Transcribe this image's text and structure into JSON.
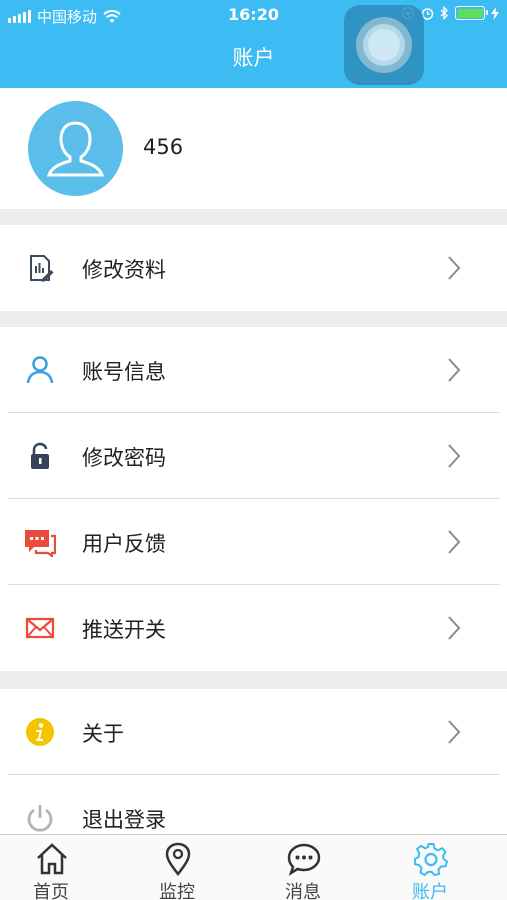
{
  "status_bar": {
    "carrier": "中国移动",
    "time": "16:20"
  },
  "header": {
    "title": "账户"
  },
  "profile": {
    "username": "456"
  },
  "menu": [
    {
      "label": "修改资料",
      "icon": "edit-profile-icon"
    },
    {
      "label": "账号信息",
      "icon": "user-icon",
      "color": "#3a9fe0"
    },
    {
      "label": "修改密码",
      "icon": "lock-icon",
      "color": "#34435a"
    },
    {
      "label": "用户反馈",
      "icon": "feedback-icon",
      "color": "#e94b3c"
    },
    {
      "label": "推送开关",
      "icon": "mail-icon",
      "color": "#e94b3c"
    },
    {
      "label": "关于",
      "icon": "info-icon",
      "color": "#f5c400"
    },
    {
      "label": "退出登录",
      "icon": "power-icon",
      "color": "#b0b6b8"
    }
  ],
  "tabs": [
    {
      "label": "首页",
      "icon": "home-icon"
    },
    {
      "label": "监控",
      "icon": "location-pin-icon"
    },
    {
      "label": "消息",
      "icon": "message-icon"
    },
    {
      "label": "账户",
      "icon": "gear-icon",
      "active": true
    }
  ],
  "colors": {
    "brand": "#3cbcf2",
    "background_gap": "#ececec"
  }
}
